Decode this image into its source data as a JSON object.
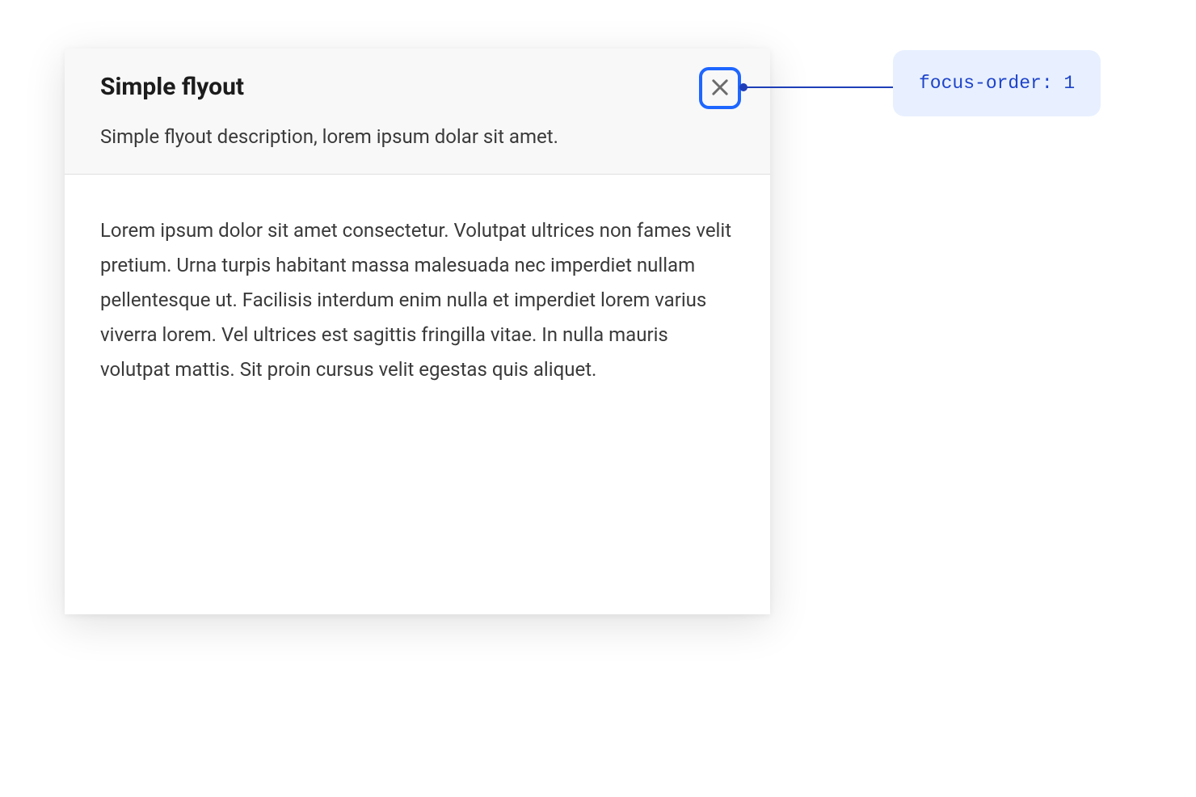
{
  "flyout": {
    "title": "Simple flyout",
    "description": "Simple flyout description, lorem ipsum dolar sit amet.",
    "body": "Lorem ipsum dolor sit amet consectetur. Volutpat ultrices non fames velit pretium. Urna turpis habitant massa malesuada nec imperdiet nullam pellentesque ut. Facilisis interdum enim nulla et imperdiet lorem varius viverra lorem. Vel ultrices est sagittis fringilla vitae. In nulla mauris volutpat mattis. Sit proin cursus velit egestas quis aliquet."
  },
  "annotation": {
    "label": "focus-order: 1"
  }
}
